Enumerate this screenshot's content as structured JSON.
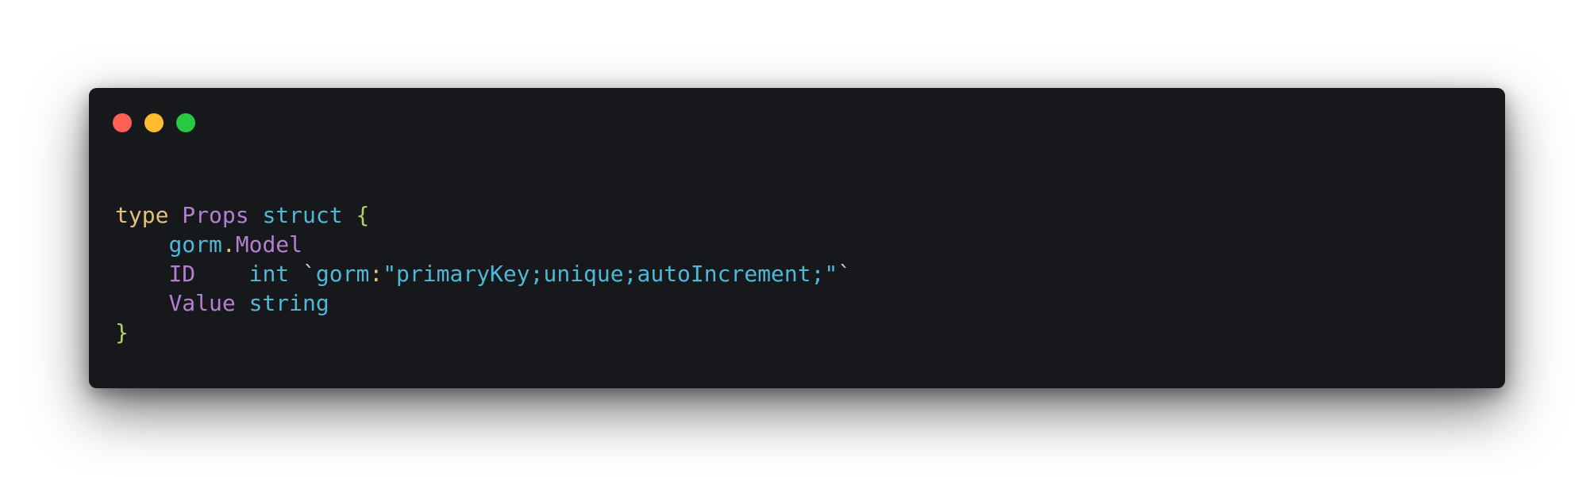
{
  "window": {
    "controls": [
      "close",
      "minimize",
      "maximize"
    ],
    "colors": {
      "background": "#17181b",
      "close": "#ff5f57",
      "minimize": "#febc2e",
      "maximize": "#28c840"
    }
  },
  "code": {
    "language": "go",
    "lines": [
      {
        "kw_type": "type",
        "name": "Props",
        "kw_struct": "struct",
        "open_brace": "{"
      },
      {
        "indent": "    ",
        "pkg": "gorm",
        "dot": ".",
        "member": "Model"
      },
      {
        "indent": "    ",
        "field": "ID",
        "pad": "    ",
        "type": "int",
        "backtick_open": "`",
        "tag_key": "gorm",
        "colon": ":",
        "tag_value": "\"primaryKey;unique;autoIncrement;\"",
        "backtick_close": "`"
      },
      {
        "indent": "    ",
        "field": "Value",
        "type": "string"
      },
      {
        "close_brace": "}"
      }
    ]
  }
}
